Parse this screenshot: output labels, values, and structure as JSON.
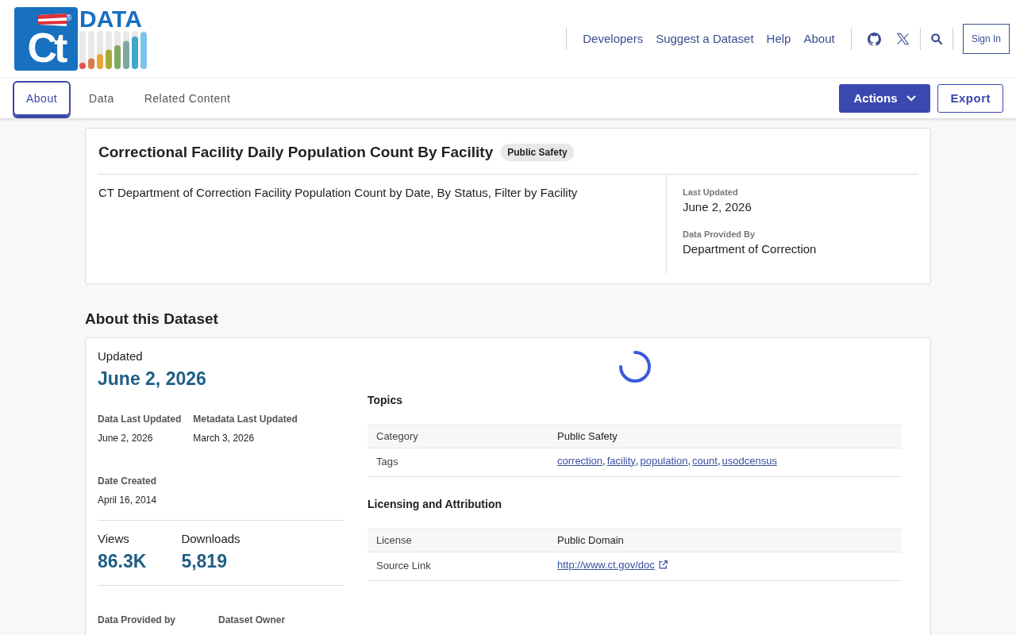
{
  "logo": {
    "mark": "Ct",
    "registered": "®",
    "wordmark": "DATA"
  },
  "header_nav": [
    "Developers",
    "Suggest a Dataset",
    "Help",
    "About"
  ],
  "sign_in": "Sign In",
  "tabs": [
    {
      "label": "About",
      "selected": true
    },
    {
      "label": "Data",
      "selected": false
    },
    {
      "label": "Related Content",
      "selected": false
    }
  ],
  "actions_button": "Actions",
  "export_button": "Export",
  "dataset": {
    "title": "Correctional Facility Daily Population Count By Facility",
    "category_badge": "Public Safety",
    "description": "CT Department of Correction Facility Population Count by Date, By Status, Filter by Facility",
    "meta": [
      {
        "label": "Last Updated",
        "value": "June 2, 2026"
      },
      {
        "label": "Data Provided By",
        "value": "Department of Correction"
      }
    ]
  },
  "about": {
    "heading": "About this Dataset",
    "updated_label": "Updated",
    "updated_value": "June 2, 2026",
    "dates": [
      {
        "label": "Data Last Updated",
        "value": "June 2, 2026"
      },
      {
        "label": "Metadata Last Updated",
        "value": "March 3, 2026"
      }
    ],
    "date_created": {
      "label": "Date Created",
      "value": "April 16, 2014"
    },
    "stats": [
      {
        "label": "Views",
        "value": "86.3K"
      },
      {
        "label": "Downloads",
        "value": "5,819"
      }
    ],
    "people_labels": [
      "Data Provided by",
      "Dataset Owner"
    ],
    "sections": [
      {
        "title": "Topics",
        "rows": [
          {
            "kind": "text",
            "label": "Category",
            "value": "Public Safety"
          },
          {
            "kind": "tags",
            "label": "Tags",
            "tags": [
              "correction",
              "facility",
              "population",
              "count",
              "usodcensus"
            ],
            "separator": ","
          }
        ]
      },
      {
        "title": "Licensing and Attribution",
        "rows": [
          {
            "kind": "text",
            "label": "License",
            "value": "Public Domain"
          },
          {
            "kind": "link",
            "label": "Source Link",
            "value": "http://www.ct.gov/doc"
          }
        ]
      }
    ]
  }
}
